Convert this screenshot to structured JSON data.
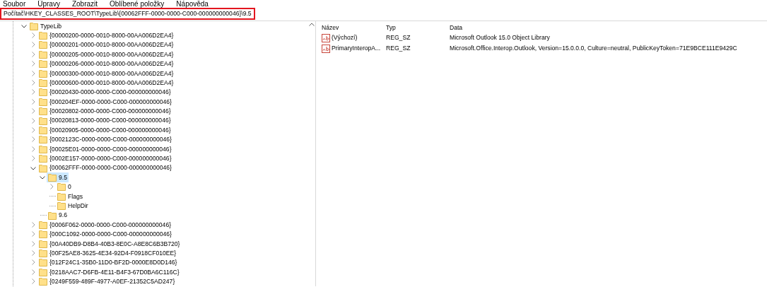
{
  "menu": [
    "Soubor",
    "Úpravy",
    "Zobrazit",
    "Oblíbené položky",
    "Nápověda"
  ],
  "address": {
    "value": "Počítač\\HKEY_CLASSES_ROOT\\TypeLib\\{00062FFF-0000-0000-C000-000000000046}\\9.5",
    "highlighted": true
  },
  "tree": {
    "label": "TypeLib",
    "expandable": true,
    "expanded": true,
    "selected": false,
    "children": [
      {
        "label": "{00000200-0000-0010-8000-00AA006D2EA4}",
        "expandable": true,
        "expanded": false,
        "selected": false
      },
      {
        "label": "{00000201-0000-0010-8000-00AA006D2EA4}",
        "expandable": true,
        "expanded": false,
        "selected": false
      },
      {
        "label": "{00000205-0000-0010-8000-00AA006D2EA4}",
        "expandable": true,
        "expanded": false,
        "selected": false
      },
      {
        "label": "{00000206-0000-0010-8000-00AA006D2EA4}",
        "expandable": true,
        "expanded": false,
        "selected": false
      },
      {
        "label": "{00000300-0000-0010-8000-00AA006D2EA4}",
        "expandable": true,
        "expanded": false,
        "selected": false
      },
      {
        "label": "{00000600-0000-0010-8000-00AA006D2EA4}",
        "expandable": true,
        "expanded": false,
        "selected": false
      },
      {
        "label": "{00020430-0000-0000-C000-000000000046}",
        "expandable": true,
        "expanded": false,
        "selected": false
      },
      {
        "label": "{000204EF-0000-0000-C000-000000000046}",
        "expandable": true,
        "expanded": false,
        "selected": false
      },
      {
        "label": "{00020802-0000-0000-C000-000000000046}",
        "expandable": true,
        "expanded": false,
        "selected": false
      },
      {
        "label": "{00020813-0000-0000-C000-000000000046}",
        "expandable": true,
        "expanded": false,
        "selected": false
      },
      {
        "label": "{00020905-0000-0000-C000-000000000046}",
        "expandable": true,
        "expanded": false,
        "selected": false
      },
      {
        "label": "{0002123C-0000-0000-C000-000000000046}",
        "expandable": true,
        "expanded": false,
        "selected": false
      },
      {
        "label": "{00025E01-0000-0000-C000-000000000046}",
        "expandable": true,
        "expanded": false,
        "selected": false
      },
      {
        "label": "{0002E157-0000-0000-C000-000000000046}",
        "expandable": true,
        "expanded": false,
        "selected": false
      },
      {
        "label": "{00062FFF-0000-0000-C000-000000000046}",
        "expandable": true,
        "expanded": true,
        "selected": false,
        "children": [
          {
            "label": "9.5",
            "expandable": true,
            "expanded": true,
            "selected": true,
            "children": [
              {
                "label": "0",
                "expandable": true,
                "expanded": false,
                "selected": false
              },
              {
                "label": "Flags",
                "expandable": false,
                "selected": false
              },
              {
                "label": "HelpDir",
                "expandable": false,
                "selected": false
              }
            ]
          },
          {
            "label": "9.6",
            "expandable": false,
            "selected": false
          }
        ]
      },
      {
        "label": "{0006F062-0000-0000-C000-000000000046}",
        "expandable": true,
        "expanded": false,
        "selected": false
      },
      {
        "label": "{000C1092-0000-0000-C000-000000000046}",
        "expandable": true,
        "expanded": false,
        "selected": false
      },
      {
        "label": "{00A40DB9-D8B4-40B3-8E0C-A8E8C6B3B720}",
        "expandable": true,
        "expanded": false,
        "selected": false
      },
      {
        "label": "{00F25AE8-3625-4E34-92D4-F0918CF010EE}",
        "expandable": true,
        "expanded": false,
        "selected": false
      },
      {
        "label": "{012F24C1-35B0-11D0-BF2D-0000E8D0D146}",
        "expandable": true,
        "expanded": false,
        "selected": false
      },
      {
        "label": "{0218AAC7-D6FB-4E11-B4F3-67D0BA6C116C}",
        "expandable": true,
        "expanded": false,
        "selected": false
      },
      {
        "label": "{0249F559-489F-4977-A0EF-21352C5AD247}",
        "expandable": true,
        "expanded": false,
        "selected": false
      }
    ]
  },
  "values": {
    "columns": [
      "Název",
      "Typ",
      "Data"
    ],
    "rows": [
      {
        "name": "(Výchozí)",
        "type": "REG_SZ",
        "data": "Microsoft Outlook 15.0 Object Library"
      },
      {
        "name": "PrimaryInteropA...",
        "type": "REG_SZ",
        "data": "Microsoft.Office.Interop.Outlook, Version=15.0.0.0, Culture=neutral, PublicKeyToken=71E9BCE111E9429C"
      }
    ]
  }
}
